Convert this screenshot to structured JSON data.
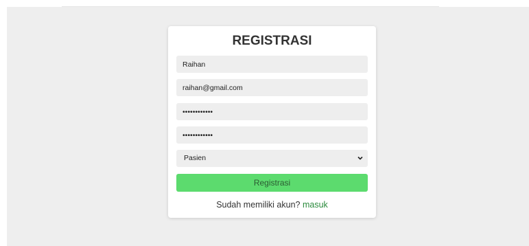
{
  "form": {
    "title": "REGISTRASI",
    "name_value": "Raihan",
    "email_value": "raihan@gmail.com",
    "password_value": "••••••••••••",
    "confirm_password_value": "••••••••••••",
    "role_selected": "Pasien",
    "submit_label": "Registrasi",
    "footer_text": "Sudah memiliki akun?",
    "login_link": "masuk"
  },
  "colors": {
    "background": "#eeeeee",
    "card": "#ffffff",
    "button": "#5cdb6e",
    "link": "#2a8a3c"
  },
  "icons": {
    "select_chevron": "chevron-down-icon"
  }
}
